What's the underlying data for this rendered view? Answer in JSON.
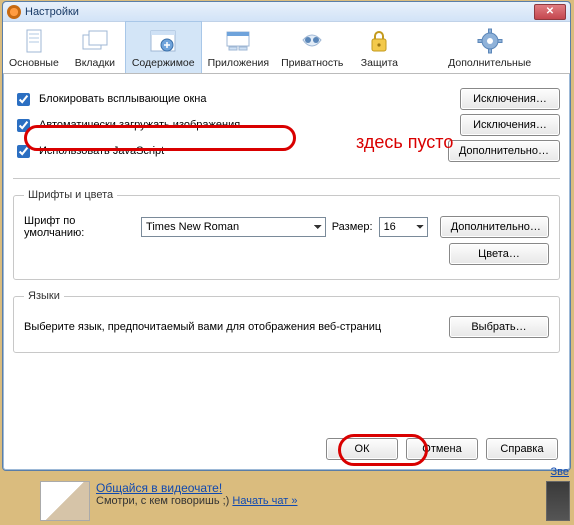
{
  "window": {
    "title": "Настройки"
  },
  "tabs": [
    {
      "label": "Основные"
    },
    {
      "label": "Вкладки"
    },
    {
      "label": "Содержимое"
    },
    {
      "label": "Приложения"
    },
    {
      "label": "Приватность"
    },
    {
      "label": "Защита"
    },
    {
      "label": "Дополнительные"
    }
  ],
  "content": {
    "cb_block_popup": "Блокировать всплывающие окна",
    "cb_auto_images": "Автоматически загружать изображения",
    "cb_javascript": "Использовать JavaScript",
    "btn_exceptions": "Исключения…",
    "btn_advanced": "Дополнительно…"
  },
  "hints": {
    "empty_here": "здесь пусто"
  },
  "fonts": {
    "legend": "Шрифты и цвета",
    "default_font_label": "Шрифт по умолчанию:",
    "default_font_value": "Times New Roman",
    "size_label": "Размер:",
    "size_value": "16",
    "btn_advanced": "Дополнительно…",
    "btn_colors": "Цвета…"
  },
  "langs": {
    "legend": "Языки",
    "description": "Выберите язык, предпочитаемый вами для отображения веб-страниц",
    "btn_choose": "Выбрать…"
  },
  "footer": {
    "ok": "ОК",
    "cancel": "Отмена",
    "help": "Справка"
  },
  "ad": {
    "title": "Общайся в видеочате!",
    "sub": "Смотри, с кем говоришь ;) ",
    "start": "Начать чат »",
    "right_label": "Зве"
  }
}
